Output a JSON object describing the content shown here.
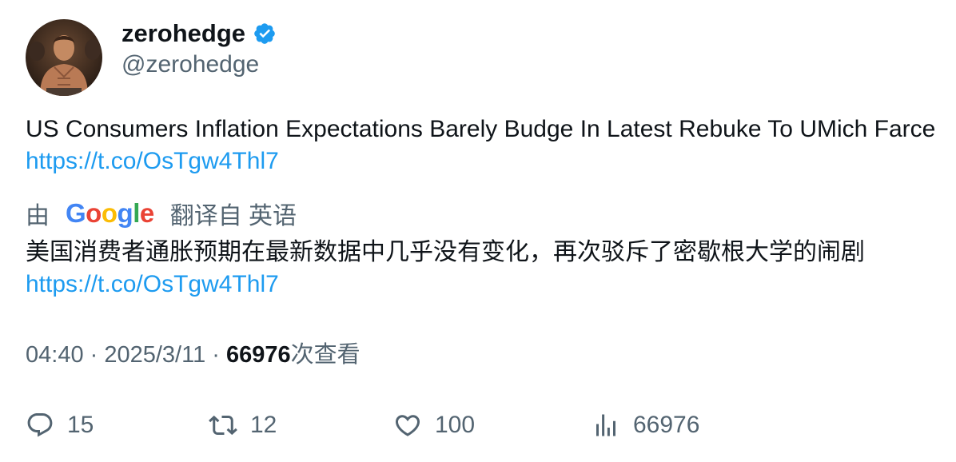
{
  "author": {
    "display_name": "zerohedge",
    "handle": "@zerohedge",
    "verified_icon": "verified-badge-icon",
    "avatar_icon": "avatar-photo"
  },
  "tweet": {
    "text": "US Consumers Inflation Expectations Barely Budge In Latest Rebuke To UMich Farce ",
    "link": "https://t.co/OsTgw4Thl7"
  },
  "translation": {
    "prefix": "由",
    "provider": "Google",
    "suffix": "翻译自 英语",
    "text": "美国消费者通胀预期在最新数据中几乎没有变化，再次驳斥了密歇根大学的闹剧",
    "link": "https://t.co/OsTgw4Thl7"
  },
  "meta": {
    "time": "04:40",
    "separator": " · ",
    "date": "2025/3/11",
    "views_count": "66976",
    "views_label": "次查看"
  },
  "actions": {
    "replies": "15",
    "retweets": "12",
    "likes": "100",
    "views": "66976"
  },
  "colors": {
    "link": "#1d9bf0",
    "muted": "#536471",
    "text": "#0f1419",
    "verified": "#1d9bf0"
  }
}
